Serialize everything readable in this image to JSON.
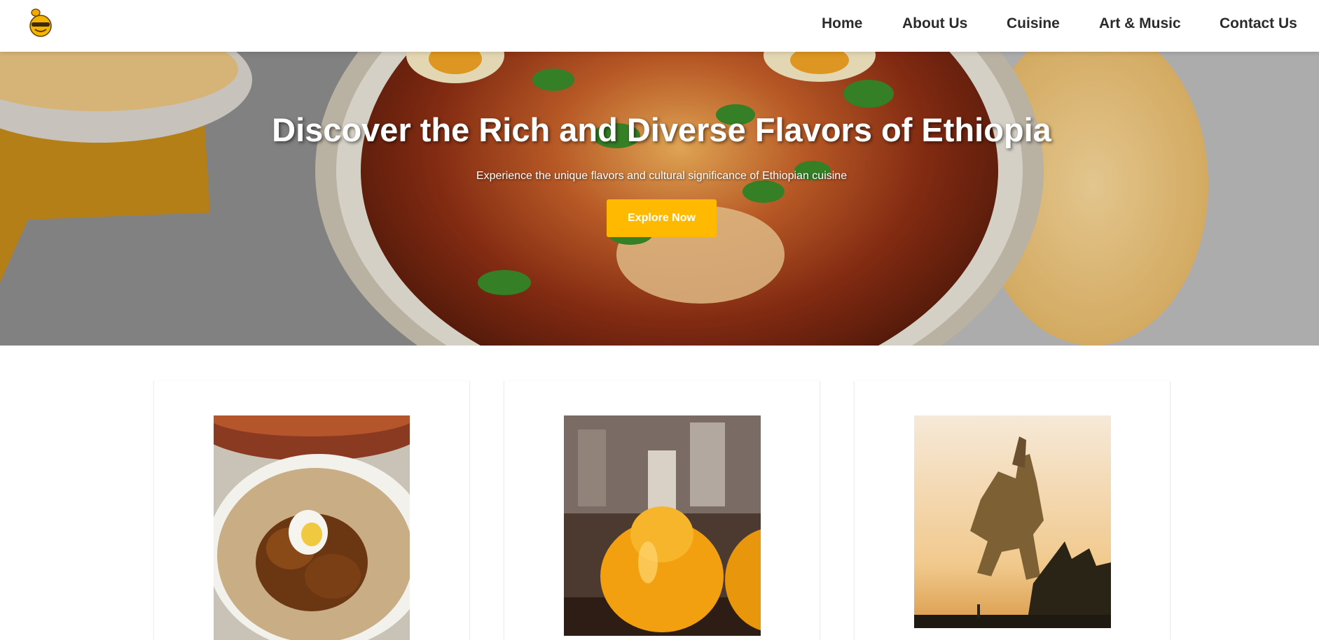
{
  "navbar": {
    "logo_icon": "chef-mascot-icon",
    "links": [
      "Home",
      "About Us",
      "Cuisine",
      "Art & Music",
      "Contact Us"
    ]
  },
  "hero": {
    "title": "Discover the Rich and Diverse Flavors of Ethiopia",
    "subtitle": "Experience the unique flavors and cultural significance of Ethiopian cuisine",
    "button_label": "Explore Now",
    "background_image": "ethiopian-stew-bowl-with-flatbread"
  },
  "cards": [
    {
      "image": "doro-wat-chicken-on-injera"
    },
    {
      "image": "tej-honey-wine-bottles"
    },
    {
      "image": "menelik-equestrian-statue-at-sunset"
    }
  ],
  "colors": {
    "accent": "#ffba00",
    "nav_text": "#2b2b2b",
    "hero_text": "#ffffff"
  }
}
